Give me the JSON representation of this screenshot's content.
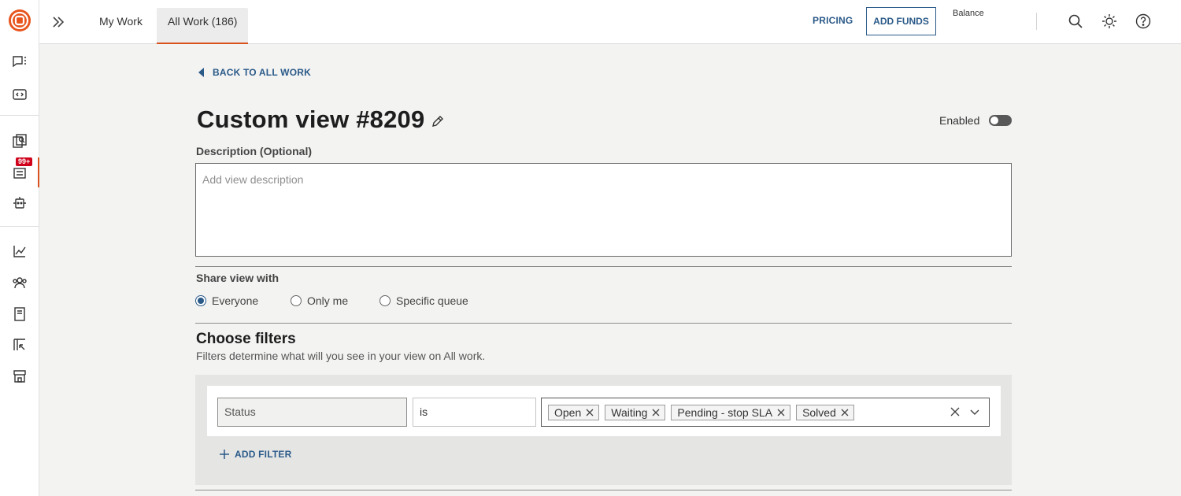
{
  "colors": {
    "accent": "#d9531e",
    "link": "#2b5a89",
    "badge": "#d0021b"
  },
  "rail": {
    "items": [
      {
        "icon": "chat-list-icon"
      },
      {
        "icon": "code-window-icon"
      },
      {
        "icon": "search-docs-icon"
      },
      {
        "icon": "inbox-work-icon",
        "badge": "99+",
        "active": true
      },
      {
        "icon": "robot-icon"
      },
      {
        "icon": "analytics-chart-icon"
      },
      {
        "icon": "people-icon"
      },
      {
        "icon": "book-icon"
      },
      {
        "icon": "import-icon"
      },
      {
        "icon": "store-icon"
      }
    ]
  },
  "topbar": {
    "tabs": [
      {
        "label": "My Work"
      },
      {
        "label": "All Work (186)",
        "active": true
      }
    ],
    "pricing": "PRICING",
    "add_funds": "ADD FUNDS",
    "balance": "Balance"
  },
  "page": {
    "back": "BACK TO ALL WORK",
    "title": "Custom view #8209",
    "enabled_label": "Enabled",
    "enabled": false,
    "description_label": "Description (Optional)",
    "description_placeholder": "Add view description",
    "description_value": "",
    "share_label": "Share view with",
    "share_options": [
      {
        "label": "Everyone",
        "selected": true
      },
      {
        "label": "Only me",
        "selected": false
      },
      {
        "label": "Specific queue",
        "selected": false
      }
    ],
    "filters_title": "Choose filters",
    "filters_subtitle": "Filters determine what will you see in your view on All work.",
    "filter": {
      "field": "Status",
      "operator": "is",
      "values": [
        "Open",
        "Waiting",
        "Pending - stop SLA",
        "Solved"
      ]
    },
    "add_filter": "ADD FILTER"
  }
}
